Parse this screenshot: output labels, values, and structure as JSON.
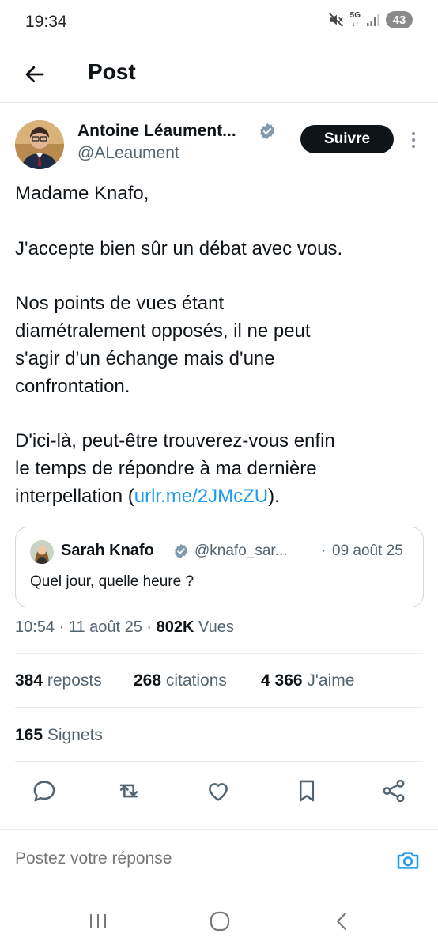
{
  "status_bar": {
    "time": "19:34",
    "network": "5G",
    "battery": "43",
    "icons": [
      "mute-icon",
      "signal-icon",
      "battery-icon"
    ]
  },
  "header": {
    "title": "Post",
    "back_icon": "arrow-left-icon"
  },
  "post": {
    "author": {
      "name": "Antoine Léaument...",
      "handle": "@ALeaument",
      "verified": true
    },
    "follow_label": "Suivre",
    "body": {
      "line1": "Madame Knafo,",
      "line2": "J'accepte bien sûr un débat avec vous.",
      "line3": "Nos points de vues étant",
      "line4": "diamétralement opposés, il ne peut",
      "line5": "s'agir d'un échange mais d'une",
      "line6": "confrontation.",
      "line7": "D'ici-là, peut-être trouverez-vous enfin",
      "line8": "le temps de répondre à ma dernière",
      "line9_prefix": "interpellation (",
      "link": "urlr.me/2JMcZU",
      "line9_suffix": ")."
    },
    "quote": {
      "name": "Sarah Knafo",
      "handle": "@knafo_sar...",
      "separator": "·",
      "date": "09 août 25",
      "text": "Quel jour, quelle heure ?"
    },
    "meta": {
      "time_date": "10:54 · 11 août 25 · ",
      "views_count": "802K",
      "views_label": " Vues"
    },
    "stats": {
      "reposts_count": "384",
      "reposts_label": " reposts",
      "quotes_count": "268",
      "quotes_label": " citations",
      "likes_count": "4 366",
      "likes_label": " J'aime",
      "bookmarks_count": "165",
      "bookmarks_label": " Signets"
    },
    "actions": [
      "reply-icon",
      "repost-icon",
      "like-icon",
      "bookmark-icon",
      "share-icon"
    ]
  },
  "composer": {
    "placeholder": "Postez votre réponse"
  },
  "colors": {
    "accent": "#1d9bf0",
    "text": "#0f1419",
    "muted": "#536471",
    "border": "#cfd9de"
  }
}
